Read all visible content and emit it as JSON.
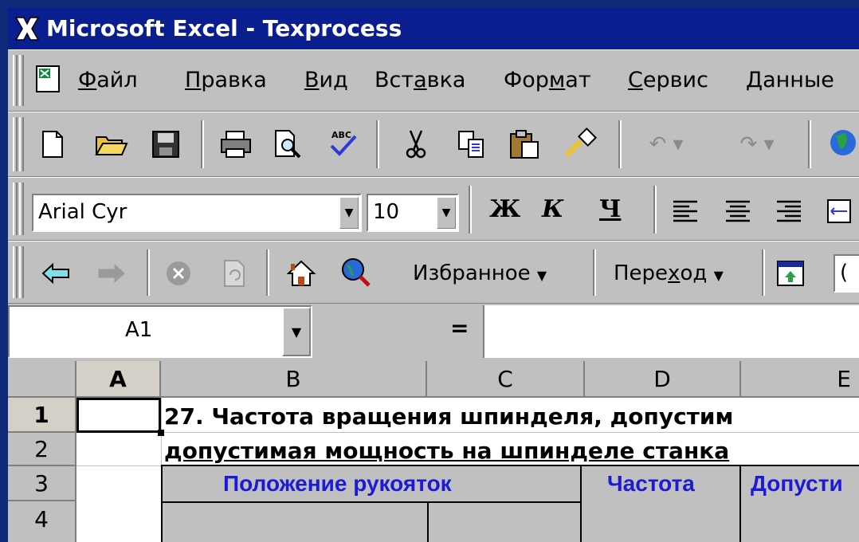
{
  "window": {
    "title": "Microsoft Excel - Texprocess",
    "bg_color": "#0e2a78",
    "titlebar_color": "#0a1f8f"
  },
  "menubar": {
    "items": [
      {
        "label": "Файл",
        "accel": "Ф",
        "rest": "айл"
      },
      {
        "label": "Правка",
        "accel": "П",
        "rest": "равка"
      },
      {
        "label": "Вид",
        "accel": "В",
        "rest": "ид",
        "pre": ""
      },
      {
        "label": "Вставка",
        "pre": "Вст",
        "accel": "а",
        "rest": "вка"
      },
      {
        "label": "Формат",
        "pre": "Фор",
        "accel": "м",
        "rest": "ат"
      },
      {
        "label": "Сервис",
        "accel": "С",
        "rest": "ервис"
      },
      {
        "label": "Данные",
        "accel": "Д",
        "rest": "анные"
      }
    ]
  },
  "standard_toolbar": {
    "icons": [
      "new-document-icon",
      "open-folder-icon",
      "save-icon",
      "print-icon",
      "print-preview-icon",
      "spelling-icon",
      "cut-icon",
      "copy-icon",
      "paste-icon",
      "format-painter-icon",
      "undo-icon",
      "redo-icon",
      "web-globe-icon"
    ]
  },
  "format_toolbar": {
    "font_name": "Arial Cyr",
    "font_size": "10",
    "bold": "Ж",
    "italic": "К",
    "underline": "Ч"
  },
  "web_toolbar": {
    "favorites": "Избранное",
    "goto_pre": "Пере",
    "goto_accel": "х",
    "goto_rest": "од",
    "address_cut": "("
  },
  "formula_bar": {
    "name_box": "A1",
    "equals": "="
  },
  "sheet": {
    "columns": [
      "A",
      "B",
      "C",
      "D",
      "E"
    ],
    "rows": [
      "1",
      "2",
      "3",
      "4"
    ],
    "row1_text": "27. Частота вращения шпинделя, допустим",
    "row2_text": "допустимая мощность на шпинделе станка",
    "table_header_1": "Положение рукояток",
    "table_header_2": "Частота",
    "table_header_3": "Допусти",
    "header_text_color": "#1b1bd6"
  }
}
